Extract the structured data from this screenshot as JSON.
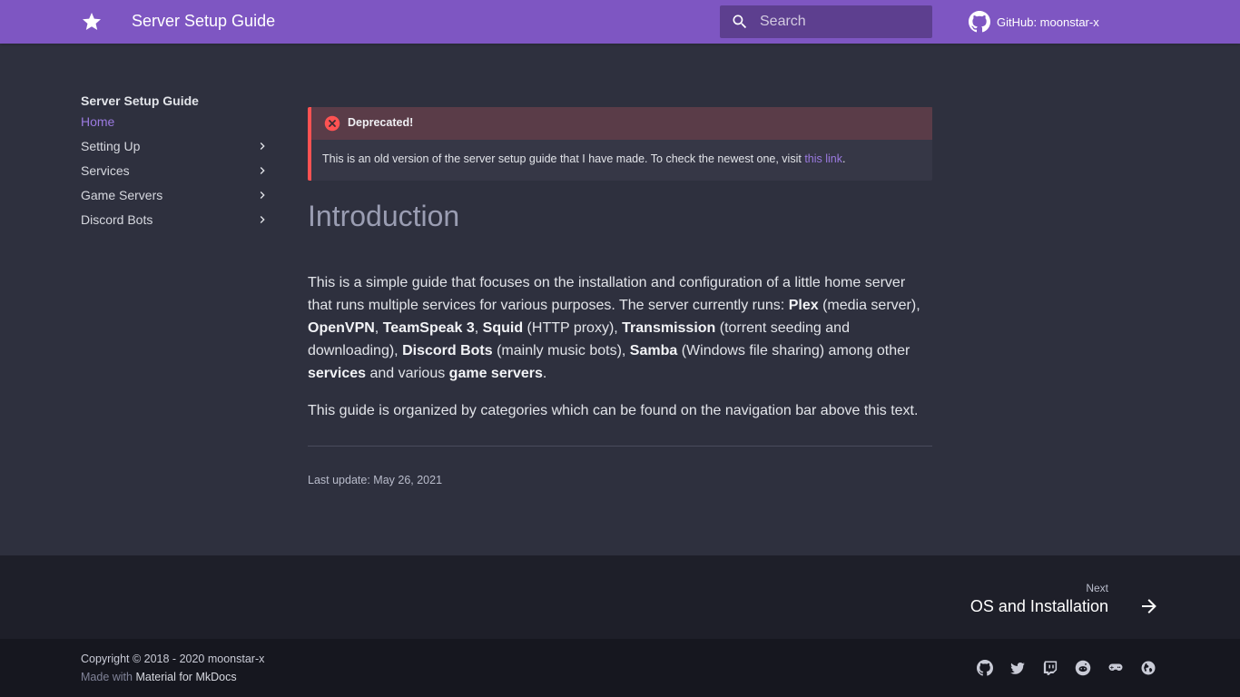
{
  "header": {
    "site_title": "Server Setup Guide",
    "search_placeholder": "Search",
    "repo_label": "GitHub: moonstar-x"
  },
  "nav": {
    "title": "Server Setup Guide",
    "items": [
      {
        "label": "Home",
        "active": true
      },
      {
        "label": "Setting Up",
        "expandable": true
      },
      {
        "label": "Services",
        "expandable": true
      },
      {
        "label": "Game Servers",
        "expandable": true
      },
      {
        "label": "Discord Bots",
        "expandable": true
      }
    ]
  },
  "admonition": {
    "title": "Deprecated!",
    "body_text": "This is an old version of the server setup guide that I have made. To check the newest one, visit ",
    "link_text": "this link",
    "body_end": "."
  },
  "article": {
    "heading": "Introduction",
    "p1": [
      "This is a simple guide that focuses on the installation and configuration of a little home server that runs multiple services for various purposes. The server currently runs: ",
      "Plex",
      " (media server), ",
      "OpenVPN",
      ", ",
      "TeamSpeak 3",
      ", ",
      "Squid",
      " (HTTP proxy), ",
      "Transmission",
      " (torrent seeding and downloading), ",
      "Discord Bots",
      " (mainly music bots), ",
      "Samba",
      " (Windows file sharing) among other ",
      "services",
      " and various ",
      "game servers",
      "."
    ],
    "p2": "This guide is organized by categories which can be found on the navigation bar above this text.",
    "last_update": "Last update: May 26, 2021"
  },
  "footer": {
    "next_label": "Next",
    "next_title": "OS and Installation",
    "copyright": "Copyright © 2018 - 2020 moonstar-x",
    "made_with": "Made with ",
    "made_with_link": "Material for MkDocs",
    "social_icons": [
      "github-icon",
      "twitter-icon",
      "twitch-icon",
      "reddit-icon",
      "gamepad-icon",
      "globe-icon"
    ]
  },
  "colors": {
    "primary": "#7e56c2",
    "accent": "#9b7ae0",
    "danger": "#ff5252",
    "background": "#2e303e"
  }
}
